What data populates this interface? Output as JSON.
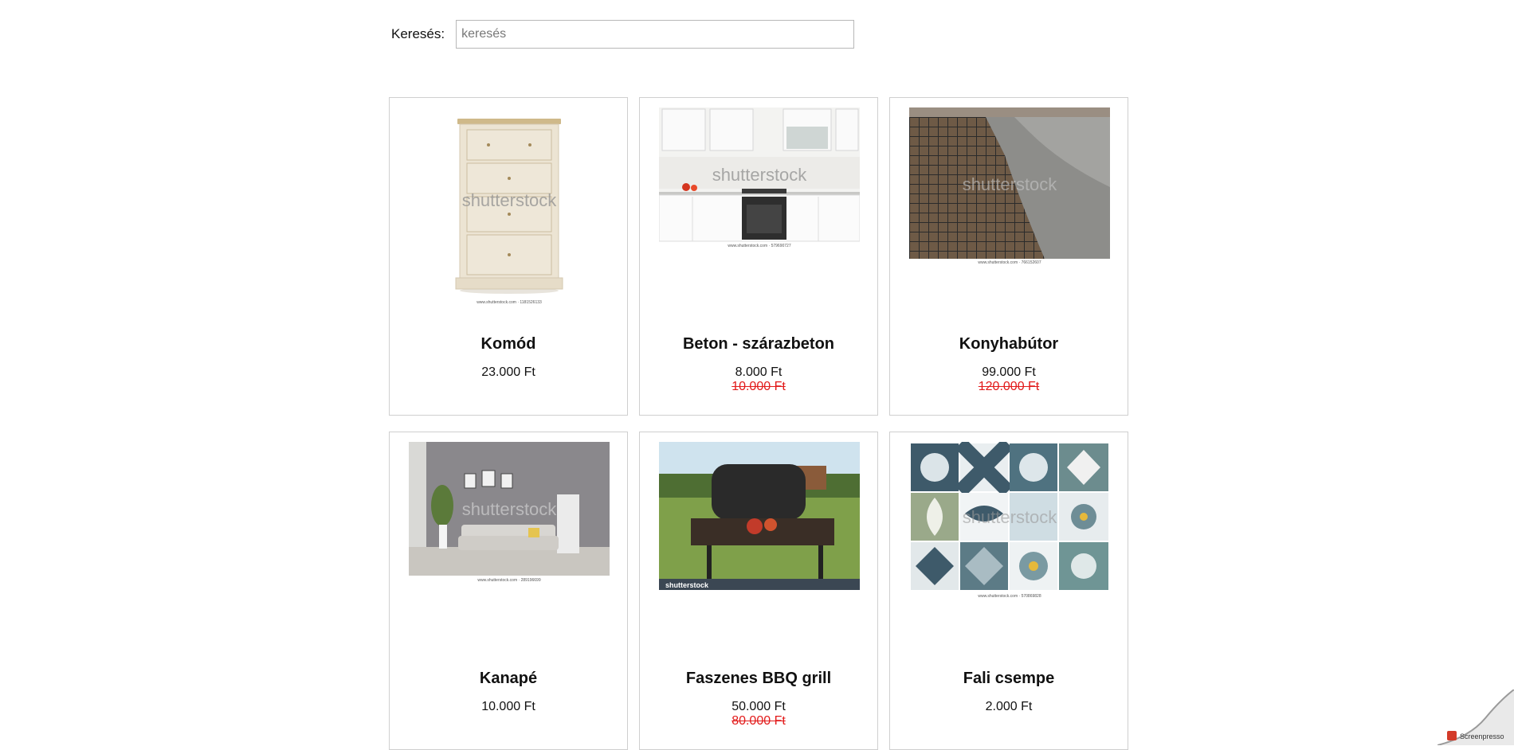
{
  "search": {
    "label": "Keresés:",
    "placeholder": "keresés",
    "value": ""
  },
  "watermark": {
    "text": "shutterstock",
    "badge": "Screenpresso"
  },
  "products": [
    {
      "name": "Komód",
      "price": "23.000 Ft",
      "old_price": "",
      "image_url": "www.shutterstock.com · 1181526133"
    },
    {
      "name": "Beton - szárazbeton",
      "price": "8.000 Ft",
      "old_price": "10.000 Ft",
      "image_url": "www.shutterstock.com · 579690727"
    },
    {
      "name": "Konyhabútor",
      "price": "99.000 Ft",
      "old_price": "120.000 Ft",
      "image_url": "www.shutterstock.com · 766152607"
    },
    {
      "name": "Kanapé",
      "price": "10.000 Ft",
      "old_price": "",
      "image_url": "www.shutterstock.com · 289196699"
    },
    {
      "name": "Faszenes BBQ grill",
      "price": "50.000 Ft",
      "old_price": "80.000 Ft",
      "image_url": ""
    },
    {
      "name": "Fali csempe",
      "price": "2.000 Ft",
      "old_price": "",
      "image_url": "www.shutterstock.com · 570869828"
    }
  ]
}
